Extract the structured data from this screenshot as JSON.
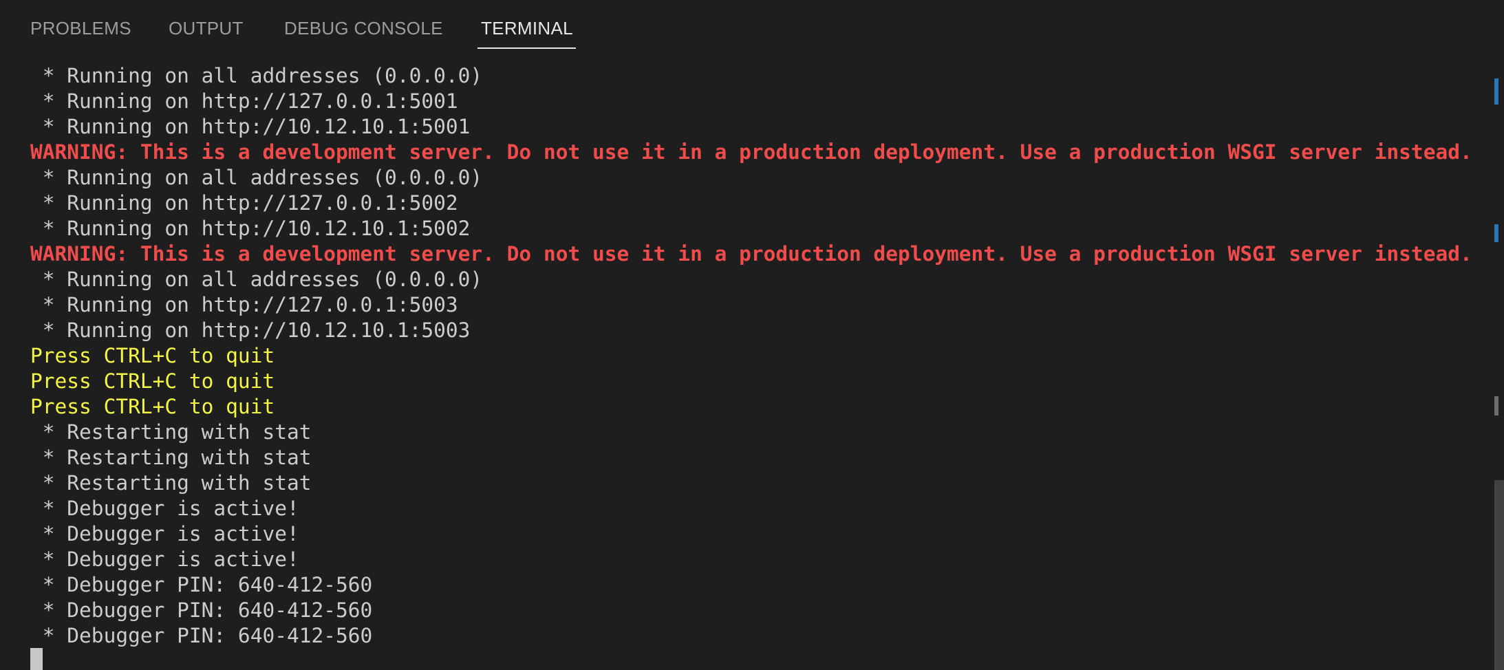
{
  "tabs": [
    {
      "label": "PROBLEMS",
      "active": false
    },
    {
      "label": "OUTPUT",
      "active": false
    },
    {
      "label": "DEBUG CONSOLE",
      "active": false
    },
    {
      "label": "TERMINAL",
      "active": true
    }
  ],
  "terminal": {
    "lines": [
      {
        "text": " * Running on all addresses (0.0.0.0)",
        "kind": "normal"
      },
      {
        "text": " * Running on http://127.0.0.1:5001",
        "kind": "normal"
      },
      {
        "text": " * Running on http://10.12.10.1:5001",
        "kind": "normal"
      },
      {
        "text": "WARNING: This is a development server. Do not use it in a production deployment. Use a production WSGI server instead.",
        "kind": "warning"
      },
      {
        "text": " * Running on all addresses (0.0.0.0)",
        "kind": "normal"
      },
      {
        "text": " * Running on http://127.0.0.1:5002",
        "kind": "normal"
      },
      {
        "text": " * Running on http://10.12.10.1:5002",
        "kind": "normal"
      },
      {
        "text": "WARNING: This is a development server. Do not use it in a production deployment. Use a production WSGI server instead.",
        "kind": "warning"
      },
      {
        "text": " * Running on all addresses (0.0.0.0)",
        "kind": "normal"
      },
      {
        "text": " * Running on http://127.0.0.1:5003",
        "kind": "normal"
      },
      {
        "text": " * Running on http://10.12.10.1:5003",
        "kind": "normal"
      },
      {
        "text": "Press CTRL+C to quit",
        "kind": "quit"
      },
      {
        "text": "Press CTRL+C to quit",
        "kind": "quit"
      },
      {
        "text": "Press CTRL+C to quit",
        "kind": "quit"
      },
      {
        "text": " * Restarting with stat",
        "kind": "normal"
      },
      {
        "text": " * Restarting with stat",
        "kind": "normal"
      },
      {
        "text": " * Restarting with stat",
        "kind": "normal"
      },
      {
        "text": " * Debugger is active!",
        "kind": "normal"
      },
      {
        "text": " * Debugger is active!",
        "kind": "normal"
      },
      {
        "text": " * Debugger is active!",
        "kind": "normal"
      },
      {
        "text": " * Debugger PIN: 640-412-560",
        "kind": "normal"
      },
      {
        "text": " * Debugger PIN: 640-412-560",
        "kind": "normal"
      },
      {
        "text": " * Debugger PIN: 640-412-560",
        "kind": "normal"
      }
    ]
  },
  "colors": {
    "background": "#1e1e1e",
    "text": "#cccccc",
    "warning": "#f14c4c",
    "quit": "#f5f543",
    "active_tab": "#e7e7e7",
    "inactive_tab": "#9d9d9d"
  }
}
